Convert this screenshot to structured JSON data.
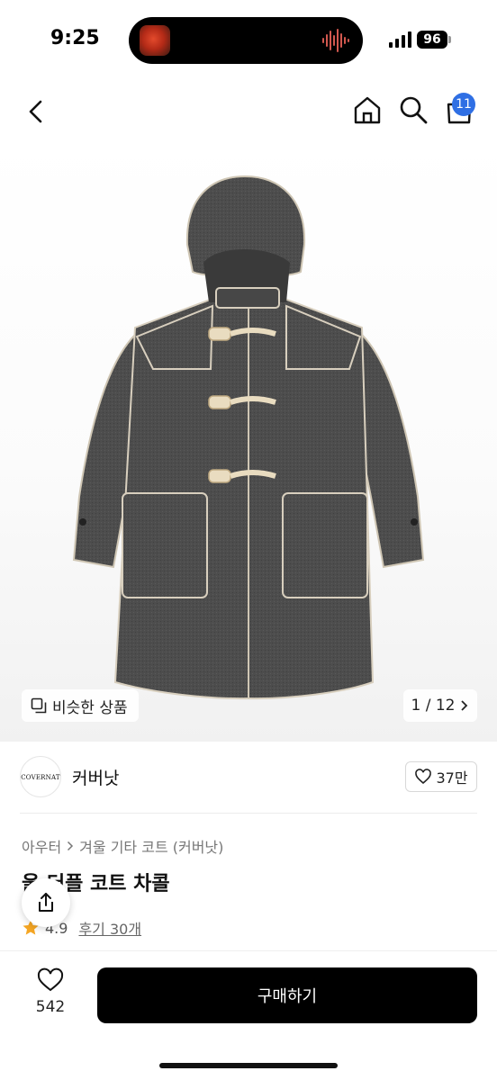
{
  "status_bar": {
    "time": "9:25",
    "battery": "96"
  },
  "nav": {
    "cart_count": "11"
  },
  "gallery": {
    "similar_label": "비슷한 상품",
    "page_current": "1",
    "page_total": "12",
    "page_text": "1 / 12"
  },
  "brand": {
    "logo_text": "COVERNAT",
    "name": "커버낫",
    "like_count": "37만"
  },
  "breadcrumb": [
    "아우터",
    "겨울 기타 코트 (커버낫)"
  ],
  "product": {
    "title": "울 더플 코트 차콜",
    "rating": "4.9",
    "review_label": "후기 30개"
  },
  "bottom_bar": {
    "wish_count": "542",
    "buy_label": "구매하기"
  },
  "colors": {
    "buy_button": "#000000",
    "badge": "#2f6fe4",
    "star": "#f5a623"
  }
}
